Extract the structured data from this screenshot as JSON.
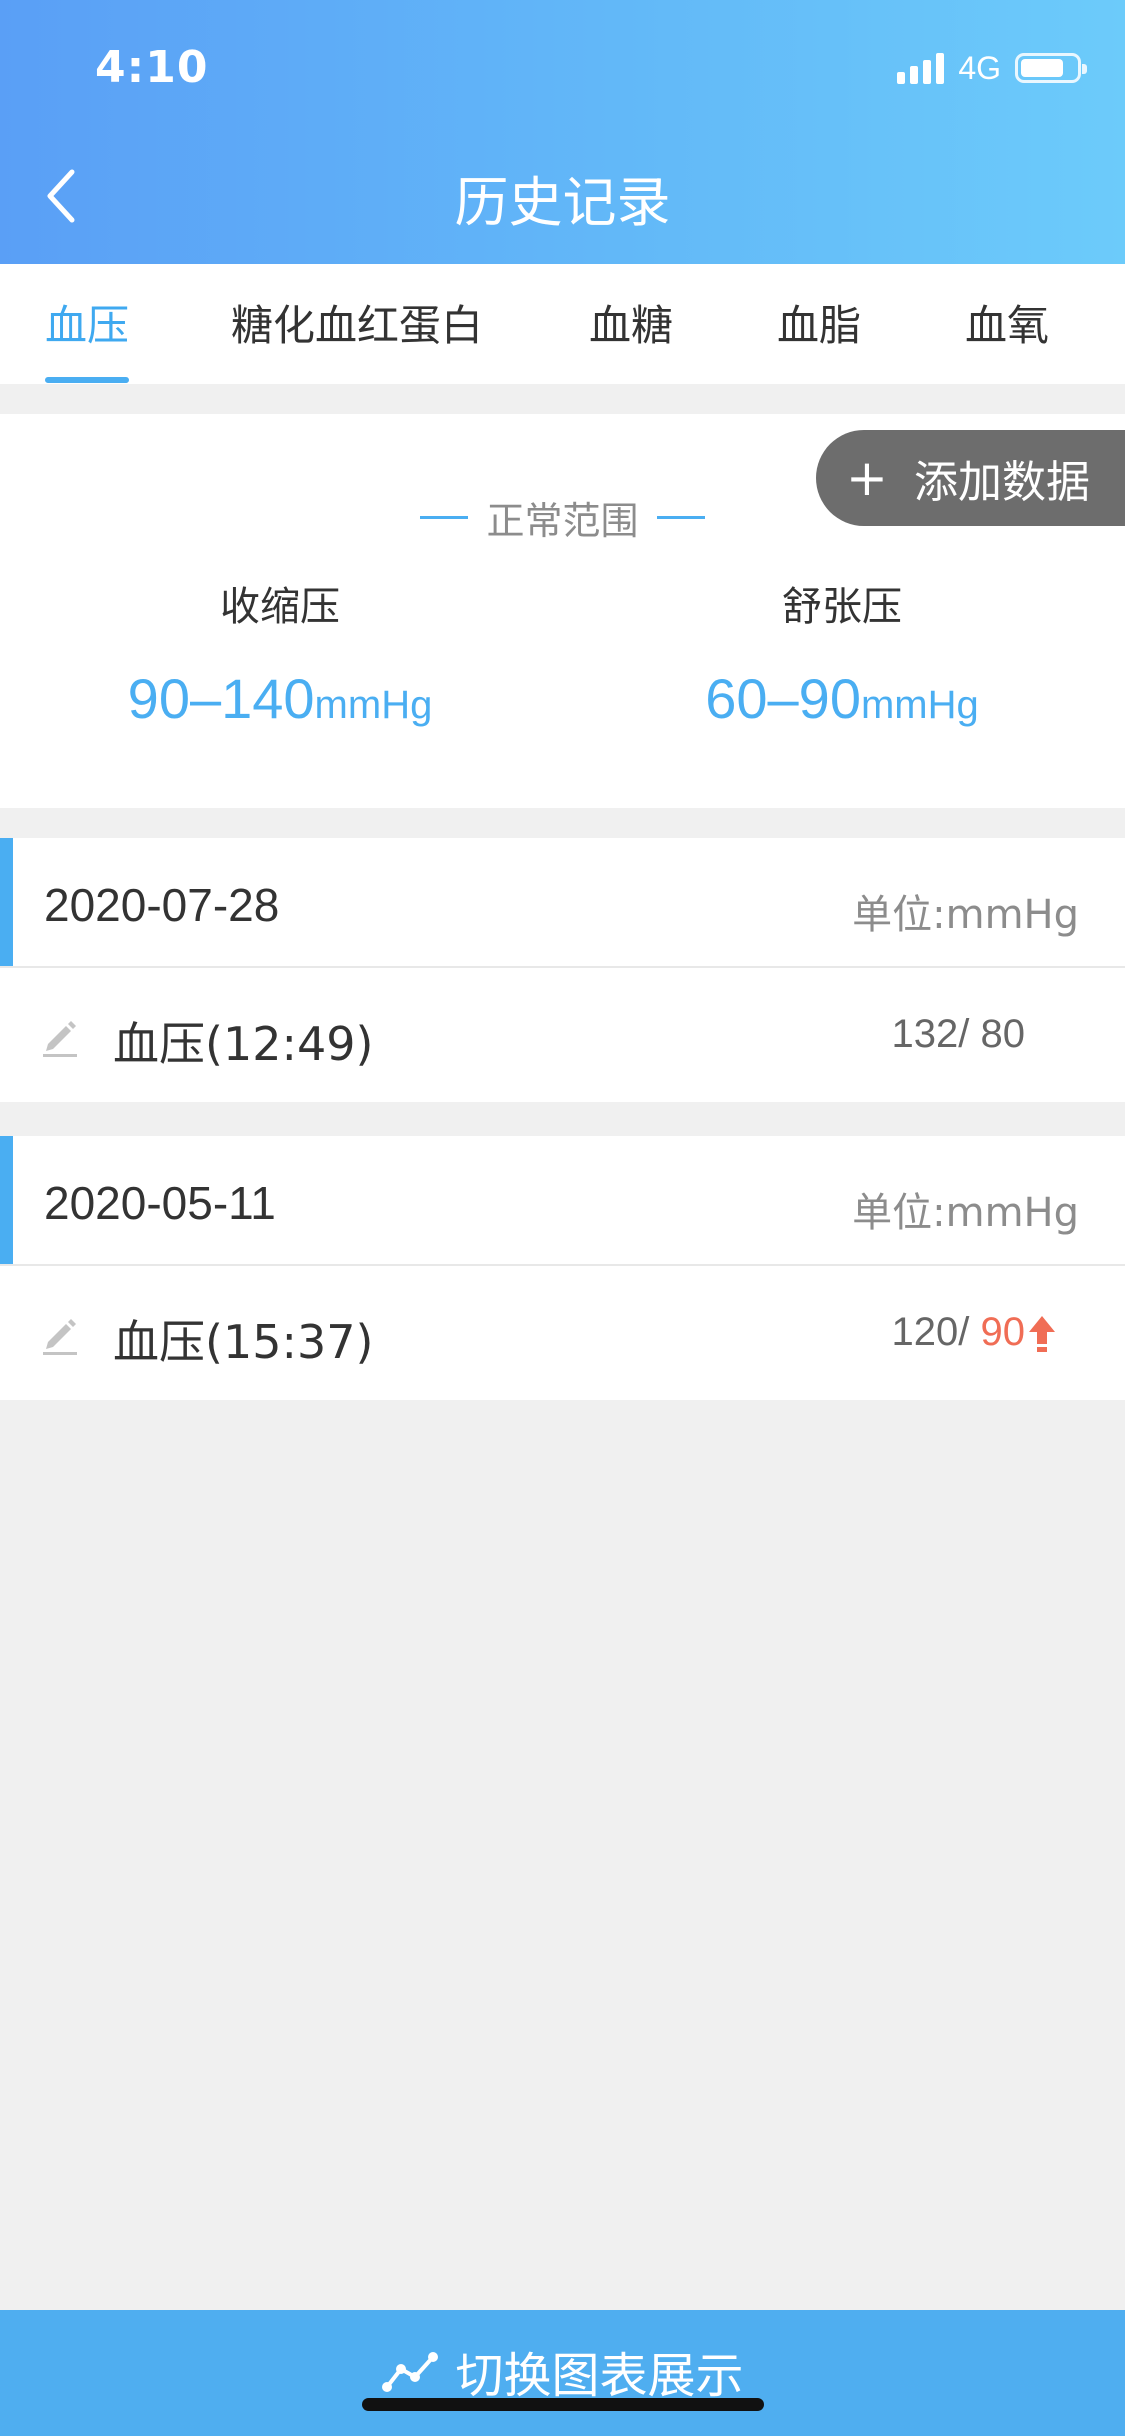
{
  "status_bar": {
    "time": "4:10",
    "network": "4G",
    "battery_level": 0.7
  },
  "header": {
    "title": "历史记录"
  },
  "tabs": [
    {
      "label": "血压",
      "active": true
    },
    {
      "label": "糖化血红蛋白",
      "active": false
    },
    {
      "label": "血糖",
      "active": false
    },
    {
      "label": "血脂",
      "active": false
    },
    {
      "label": "血氧",
      "active": false
    }
  ],
  "add_button": {
    "plus": "+",
    "label": "添加数据"
  },
  "normal_range": {
    "title": "正常范围",
    "systolic": {
      "label": "收缩压",
      "value": "90–140",
      "unit": "mmHg"
    },
    "diastolic": {
      "label": "舒张压",
      "value": "60–90",
      "unit": "mmHg"
    }
  },
  "records": [
    {
      "date": "2020-07-28",
      "unit": "单位:mmHg",
      "entries": [
        {
          "label": "血压(12:49)",
          "systolic": "132",
          "diastolic": " 80",
          "diastolic_high": false
        }
      ]
    },
    {
      "date": "2020-05-11",
      "unit": "单位:mmHg",
      "entries": [
        {
          "label": "血压(15:37)",
          "systolic": "120",
          "diastolic": " 90",
          "diastolic_high": true
        }
      ]
    }
  ],
  "bottom_bar": {
    "label": "切换图表展示"
  },
  "colors": {
    "accent": "#4aaef2",
    "header_start": "#5a9ff6",
    "header_end": "#6ccbfa",
    "alert": "#f06d55",
    "add_button": "#6d6d6d"
  }
}
